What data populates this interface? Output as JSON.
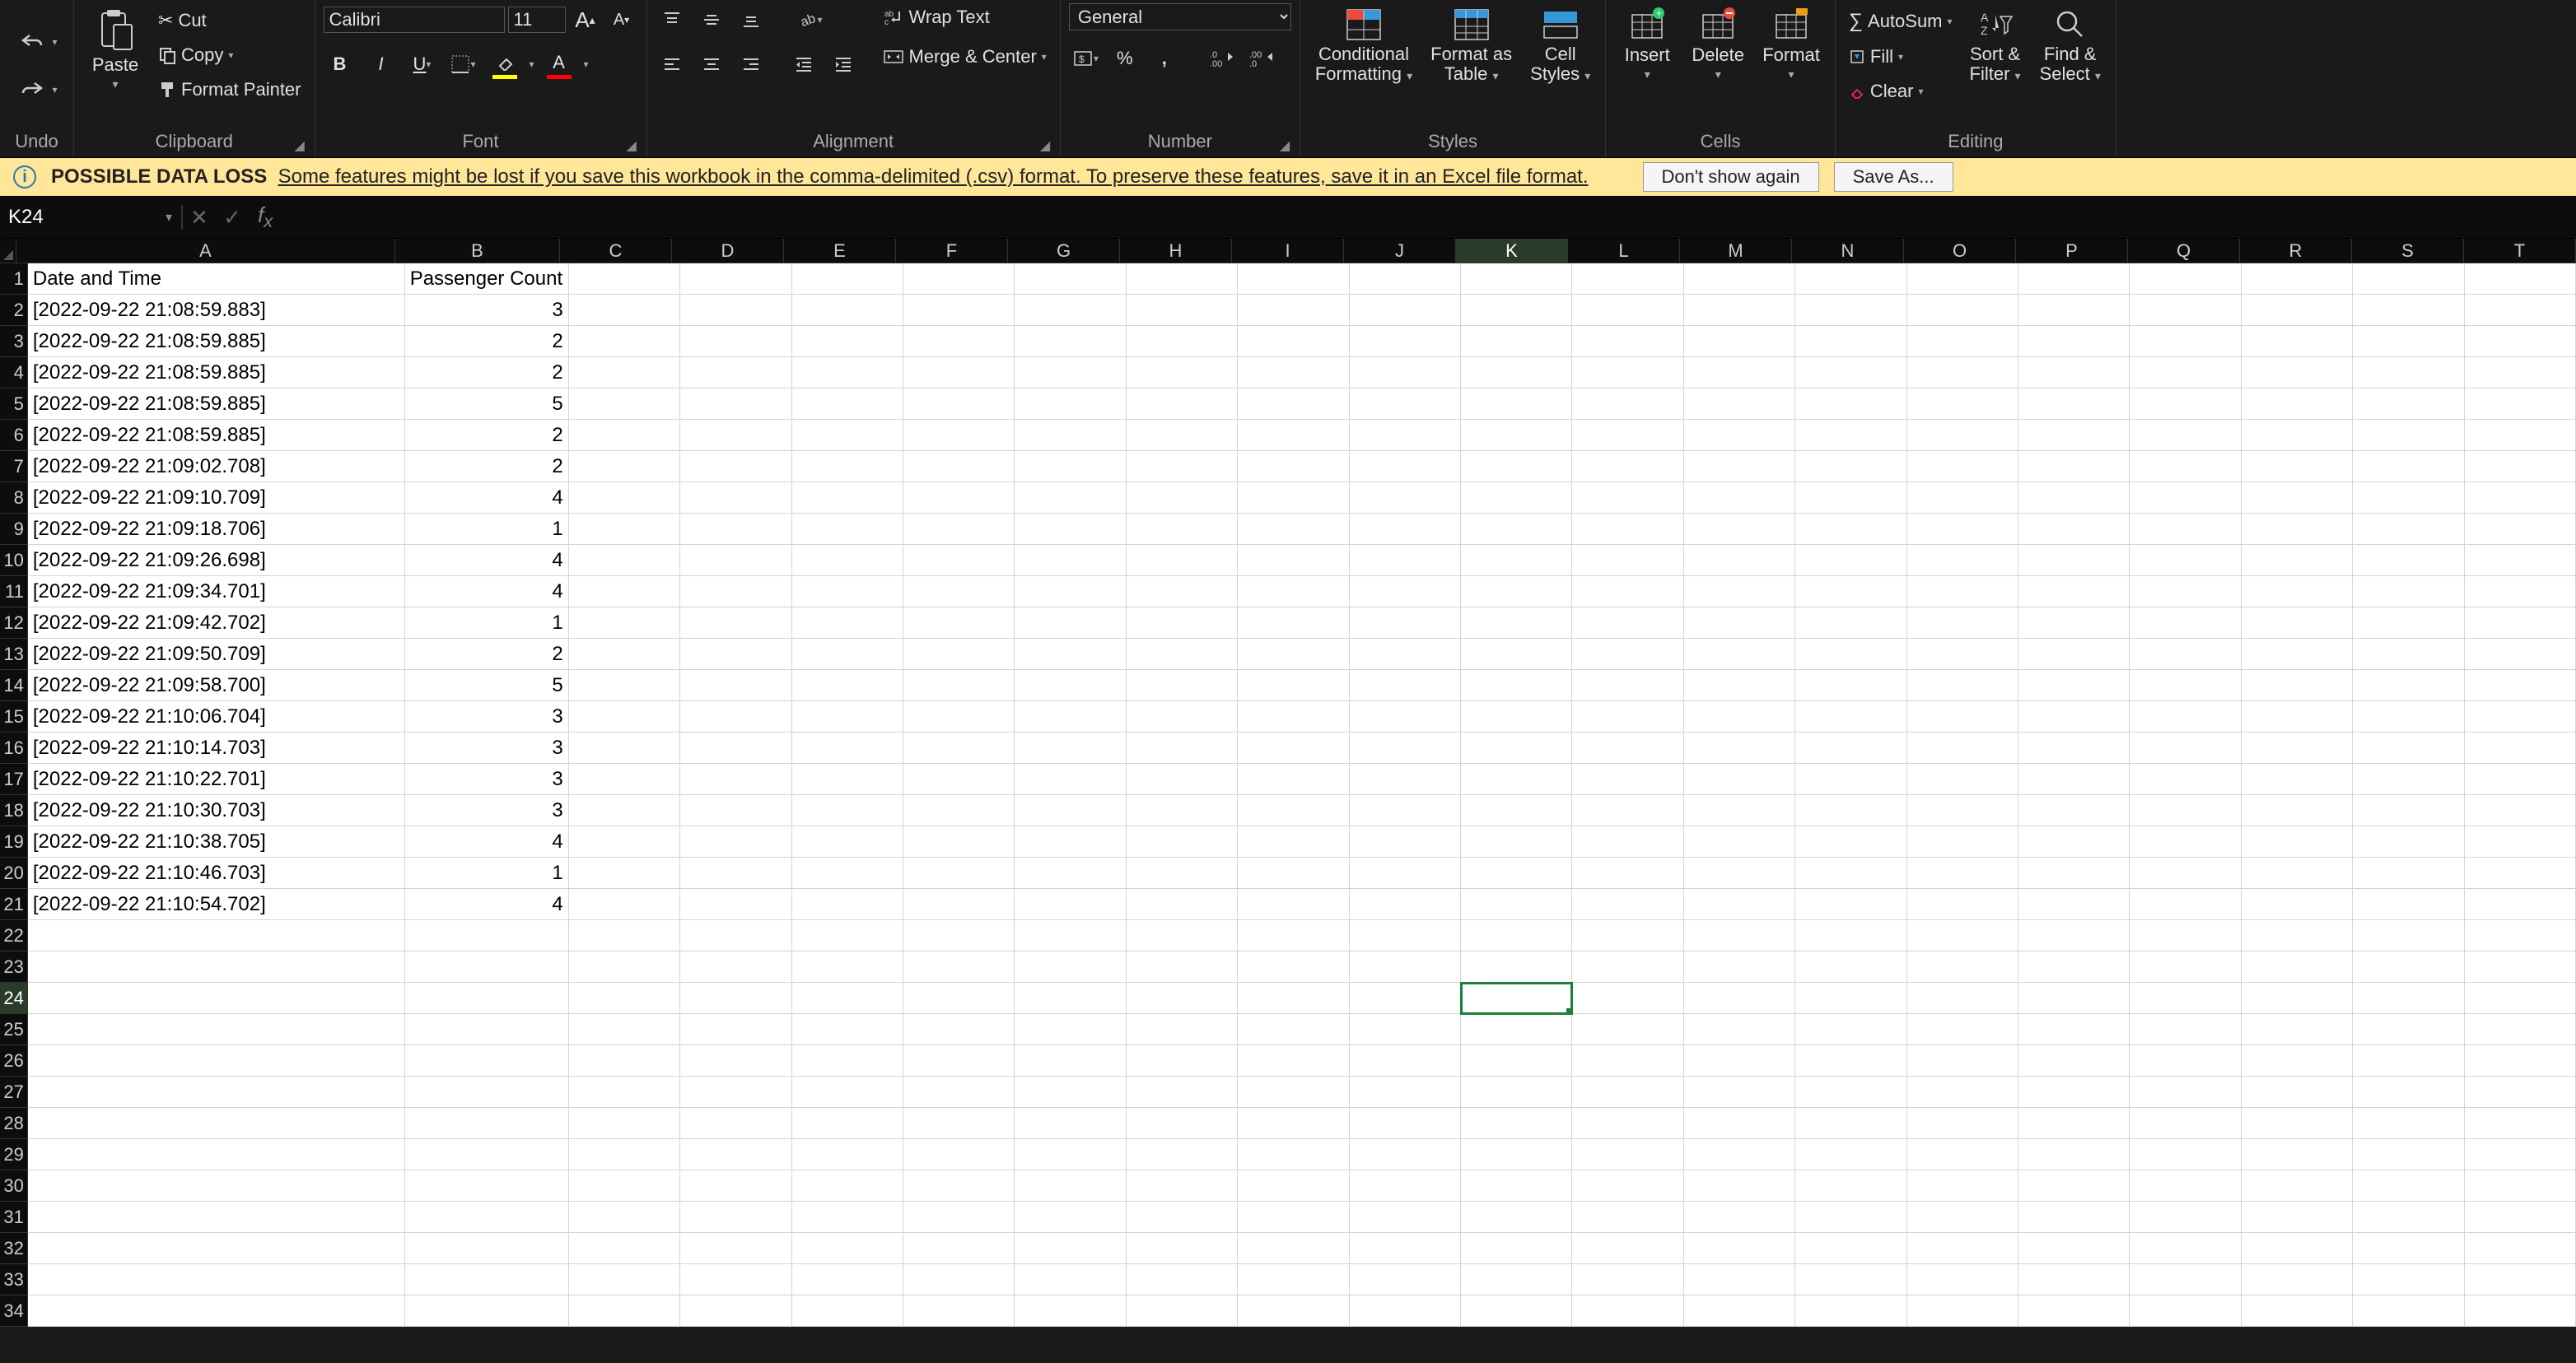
{
  "ribbon": {
    "undo_group": "Undo",
    "clipboard": {
      "paste": "Paste",
      "cut": "Cut",
      "copy": "Copy",
      "format_painter": "Format Painter",
      "label": "Clipboard"
    },
    "font": {
      "name": "Calibri",
      "size": "11",
      "label": "Font"
    },
    "alignment": {
      "wrap": "Wrap Text",
      "merge": "Merge & Center",
      "label": "Alignment"
    },
    "number": {
      "format": "General",
      "label": "Number"
    },
    "styles": {
      "cond": "Conditional Formatting",
      "table": "Format as Table",
      "cell": "Cell Styles",
      "label": "Styles"
    },
    "cells": {
      "insert": "Insert",
      "delete": "Delete",
      "format": "Format",
      "label": "Cells"
    },
    "editing": {
      "autosum": "AutoSum",
      "fill": "Fill",
      "clear": "Clear",
      "sort": "Sort & Filter",
      "find": "Find & Select",
      "label": "Editing"
    }
  },
  "msgbar": {
    "title": "POSSIBLE DATA LOSS",
    "detail": "Some features might be lost if you save this workbook in the comma-delimited (.csv) format. To preserve these features, save it in an Excel file format.",
    "btn1": "Don't show again",
    "btn2": "Save As..."
  },
  "namebox": "K24",
  "formula": "",
  "columns": [
    "A",
    "B",
    "C",
    "D",
    "E",
    "F",
    "G",
    "H",
    "I",
    "J",
    "K",
    "L",
    "M",
    "N",
    "O",
    "P",
    "Q",
    "R",
    "S",
    "T"
  ],
  "header_row": {
    "A": "Date and Time",
    "B": "Passenger Count"
  },
  "data_rows": [
    {
      "A": "[2022-09-22 21:08:59.883]",
      "B": "3"
    },
    {
      "A": "[2022-09-22 21:08:59.885]",
      "B": "2"
    },
    {
      "A": "[2022-09-22 21:08:59.885]",
      "B": "2"
    },
    {
      "A": "[2022-09-22 21:08:59.885]",
      "B": "5"
    },
    {
      "A": "[2022-09-22 21:08:59.885]",
      "B": "2"
    },
    {
      "A": "[2022-09-22 21:09:02.708]",
      "B": "2"
    },
    {
      "A": "[2022-09-22 21:09:10.709]",
      "B": "4"
    },
    {
      "A": "[2022-09-22 21:09:18.706]",
      "B": "1"
    },
    {
      "A": "[2022-09-22 21:09:26.698]",
      "B": "4"
    },
    {
      "A": "[2022-09-22 21:09:34.701]",
      "B": "4"
    },
    {
      "A": "[2022-09-22 21:09:42.702]",
      "B": "1"
    },
    {
      "A": "[2022-09-22 21:09:50.709]",
      "B": "2"
    },
    {
      "A": "[2022-09-22 21:09:58.700]",
      "B": "5"
    },
    {
      "A": "[2022-09-22 21:10:06.704]",
      "B": "3"
    },
    {
      "A": "[2022-09-22 21:10:14.703]",
      "B": "3"
    },
    {
      "A": "[2022-09-22 21:10:22.701]",
      "B": "3"
    },
    {
      "A": "[2022-09-22 21:10:30.703]",
      "B": "3"
    },
    {
      "A": "[2022-09-22 21:10:38.705]",
      "B": "4"
    },
    {
      "A": "[2022-09-22 21:10:46.703]",
      "B": "1"
    },
    {
      "A": "[2022-09-22 21:10:54.702]",
      "B": "4"
    }
  ],
  "active_cell": {
    "col": "K",
    "row": 24
  },
  "total_visible_rows": 34
}
